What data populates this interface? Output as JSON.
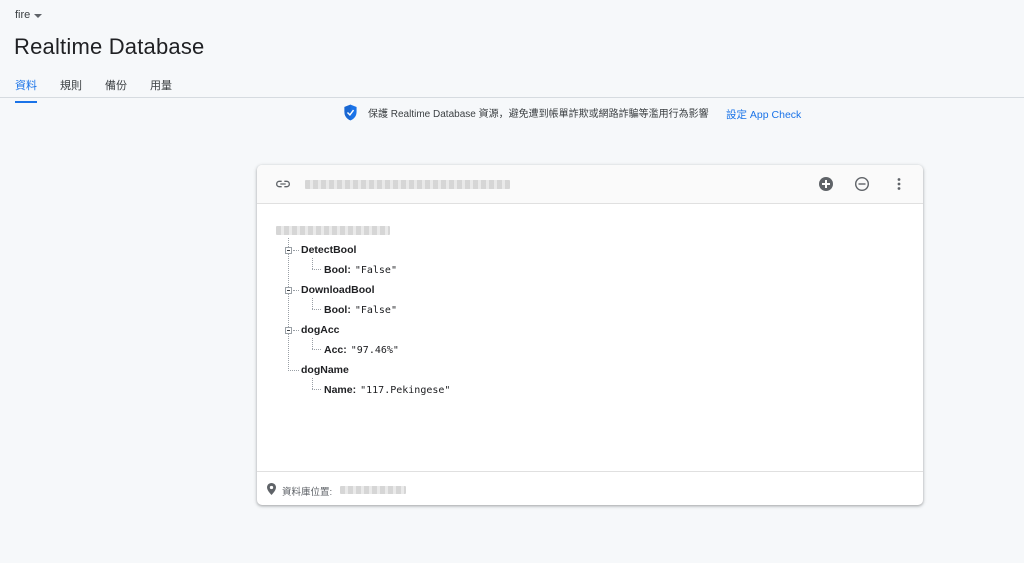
{
  "header": {
    "project_name": "fire",
    "page_title": "Realtime Database",
    "tabs": [
      {
        "label": "資料",
        "active": true
      },
      {
        "label": "規則",
        "active": false
      },
      {
        "label": "備份",
        "active": false
      },
      {
        "label": "用量",
        "active": false
      }
    ]
  },
  "banner": {
    "icon": "shield-icon",
    "text": "保護 Realtime Database 資源，避免遭到帳單詐欺或網路詐騙等濫用行為影響",
    "link_label": "設定 App Check"
  },
  "card": {
    "toolbar_icons": [
      "link-icon",
      "add-circle-icon",
      "remove-circle-icon",
      "more-vert-icon"
    ],
    "tree": [
      {
        "key": "DetectBool",
        "child_key": "Bool:",
        "child_value": "\"False\""
      },
      {
        "key": "DownloadBool",
        "child_key": "Bool:",
        "child_value": "\"False\""
      },
      {
        "key": "dogAcc",
        "child_key": "Acc:",
        "child_value": "\"97.46%\""
      },
      {
        "key": "dogName",
        "child_key": "Name:",
        "child_value": "\"117.Pekingese\""
      }
    ],
    "footer": {
      "icon": "location-pin-icon",
      "location_label": "資料庫位置:"
    }
  },
  "colors": {
    "accent": "#1a73e8",
    "background": "#f6f8fa",
    "card": "#ffffff"
  }
}
